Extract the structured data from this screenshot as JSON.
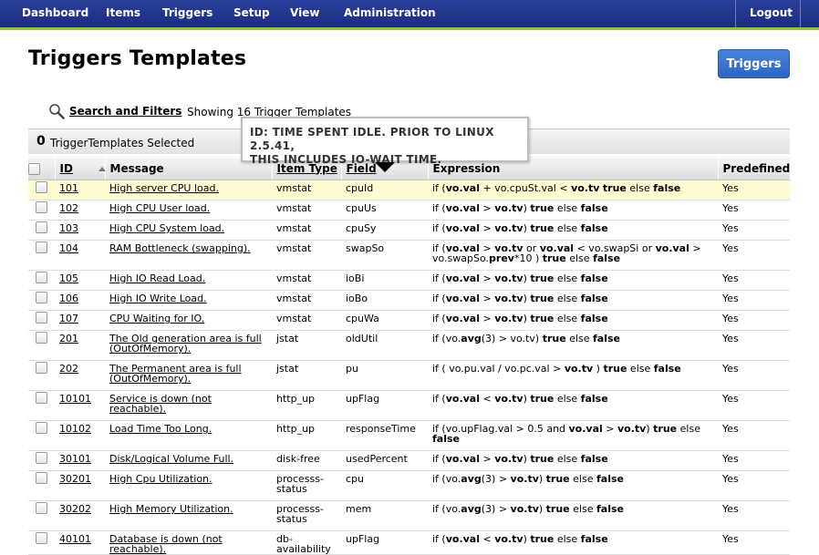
{
  "nav": {
    "items": [
      {
        "label": "Dashboard",
        "key": "dashboard"
      },
      {
        "label": "Items",
        "key": "items"
      },
      {
        "label": "Triggers",
        "key": "triggers"
      },
      {
        "label": "Setup",
        "key": "setup"
      },
      {
        "label": "View",
        "key": "view"
      },
      {
        "label": "Administration",
        "key": "administration"
      }
    ],
    "logout": "Logout"
  },
  "page": {
    "title": "Triggers Templates",
    "triggers_button": "Triggers",
    "search_link": "Search and Filters",
    "showing": "Showing 16 Trigger Templates",
    "selected_count": "0",
    "selected_label": "TriggerTemplates Selected"
  },
  "tooltip": {
    "line1": "ID: TIME SPENT IDLE. PRIOR TO LINUX 2.5.41,",
    "line2": "THIS INCLUDES IO-WAIT TIME."
  },
  "table": {
    "columns": [
      "ID",
      "Message",
      "Item Type",
      "Field",
      "Expression",
      "Predefined"
    ],
    "rows": [
      {
        "id": "101",
        "message": "High server CPU load.",
        "item_type": "vmstat",
        "field": "cpuId",
        "expression": [
          [
            "if (",
            0
          ],
          [
            "vo.val",
            1
          ],
          [
            " + vo.cpuSt.val < ",
            0
          ],
          [
            "vo.tv",
            1
          ],
          [
            " ",
            0
          ],
          [
            "true",
            1
          ],
          [
            " else ",
            0
          ],
          [
            "false",
            1
          ]
        ],
        "predefined": "Yes",
        "highlight": true
      },
      {
        "id": "102",
        "message": "High CPU User load.",
        "item_type": "vmstat",
        "field": "cpuUs",
        "expression": [
          [
            "if (",
            0
          ],
          [
            "vo.val",
            1
          ],
          [
            " > ",
            0
          ],
          [
            "vo.tv",
            1
          ],
          [
            ") ",
            0
          ],
          [
            "true",
            1
          ],
          [
            " else ",
            0
          ],
          [
            "false",
            1
          ]
        ],
        "predefined": "Yes"
      },
      {
        "id": "103",
        "message": "High CPU System load.",
        "item_type": "vmstat",
        "field": "cpuSy",
        "expression": [
          [
            "if (",
            0
          ],
          [
            "vo.val",
            1
          ],
          [
            " > ",
            0
          ],
          [
            "vo.tv",
            1
          ],
          [
            ") ",
            0
          ],
          [
            "true",
            1
          ],
          [
            " else ",
            0
          ],
          [
            "false",
            1
          ]
        ],
        "predefined": "Yes"
      },
      {
        "id": "104",
        "message": "RAM Bottleneck (swapping).",
        "item_type": "vmstat",
        "field": "swapSo",
        "expression": [
          [
            "if (",
            0
          ],
          [
            "vo.val",
            1
          ],
          [
            " > ",
            0
          ],
          [
            "vo.tv",
            1
          ],
          [
            " or ",
            0
          ],
          [
            "vo.val",
            1
          ],
          [
            " < vo.swapSi or ",
            0
          ],
          [
            "vo.val",
            1
          ],
          [
            " > vo.swapSo.",
            0
          ],
          [
            "prev",
            1
          ],
          [
            "*10 ) ",
            0
          ],
          [
            "true",
            1
          ],
          [
            " else ",
            0
          ],
          [
            "false",
            1
          ]
        ],
        "predefined": "Yes"
      },
      {
        "id": "105",
        "message": "High IO Read Load.",
        "item_type": "vmstat",
        "field": "ioBi",
        "expression": [
          [
            "if (",
            0
          ],
          [
            "vo.val",
            1
          ],
          [
            " > ",
            0
          ],
          [
            "vo.tv",
            1
          ],
          [
            ") ",
            0
          ],
          [
            "true",
            1
          ],
          [
            " else ",
            0
          ],
          [
            "false",
            1
          ]
        ],
        "predefined": "Yes"
      },
      {
        "id": "106",
        "message": "High IO Write Load.",
        "item_type": "vmstat",
        "field": "ioBo",
        "expression": [
          [
            "if (",
            0
          ],
          [
            "vo.val",
            1
          ],
          [
            " > ",
            0
          ],
          [
            "vo.tv",
            1
          ],
          [
            ") ",
            0
          ],
          [
            "true",
            1
          ],
          [
            " else ",
            0
          ],
          [
            "false",
            1
          ]
        ],
        "predefined": "Yes"
      },
      {
        "id": "107",
        "message": "CPU Waiting for IO.",
        "item_type": "vmstat",
        "field": "cpuWa",
        "expression": [
          [
            "if (",
            0
          ],
          [
            "vo.val",
            1
          ],
          [
            " > ",
            0
          ],
          [
            "vo.tv",
            1
          ],
          [
            ") ",
            0
          ],
          [
            "true",
            1
          ],
          [
            " else ",
            0
          ],
          [
            "false",
            1
          ]
        ],
        "predefined": "Yes"
      },
      {
        "id": "201",
        "message": "The Old generation area is full (OutOfMemory).",
        "item_type": "jstat",
        "field": "oldUtil",
        "expression": [
          [
            "if (vo.",
            0
          ],
          [
            "avg",
            1
          ],
          [
            "(3) > vo.tv) ",
            0
          ],
          [
            "true",
            1
          ],
          [
            " else ",
            0
          ],
          [
            "false",
            1
          ]
        ],
        "predefined": "Yes"
      },
      {
        "id": "202",
        "message": "The Permanent area is full (OutOfMemory).",
        "item_type": "jstat",
        "field": "pu",
        "expression": [
          [
            "if ( vo.pu.val / vo.pc.val > ",
            0
          ],
          [
            "vo.tv",
            1
          ],
          [
            " ) ",
            0
          ],
          [
            "true",
            1
          ],
          [
            " else ",
            0
          ],
          [
            "false",
            1
          ]
        ],
        "predefined": "Yes"
      },
      {
        "id": "10101",
        "message": "Service is down (not reachable).",
        "item_type": "http_up",
        "field": "upFlag",
        "expression": [
          [
            "if (",
            0
          ],
          [
            "vo.val",
            1
          ],
          [
            " < ",
            0
          ],
          [
            "vo.tv",
            1
          ],
          [
            ") ",
            0
          ],
          [
            "true",
            1
          ],
          [
            " else ",
            0
          ],
          [
            "false",
            1
          ]
        ],
        "predefined": "Yes"
      },
      {
        "id": "10102",
        "message": "Load Time Too Long.",
        "item_type": "http_up",
        "field": "responseTime",
        "expression": [
          [
            "if (vo.upFlag.val > 0.5 and ",
            0
          ],
          [
            "vo.val",
            1
          ],
          [
            " > ",
            0
          ],
          [
            "vo.tv",
            1
          ],
          [
            ") ",
            0
          ],
          [
            "true",
            1
          ],
          [
            " else ",
            0
          ],
          [
            "false",
            1
          ]
        ],
        "predefined": "Yes"
      },
      {
        "id": "30101",
        "message": "Disk/Logical Volume Full.",
        "item_type": "disk-free",
        "field": "usedPercent",
        "expression": [
          [
            "if (",
            0
          ],
          [
            "vo.val",
            1
          ],
          [
            " > ",
            0
          ],
          [
            "vo.tv",
            1
          ],
          [
            ") ",
            0
          ],
          [
            "true",
            1
          ],
          [
            " else ",
            0
          ],
          [
            "false",
            1
          ]
        ],
        "predefined": "Yes"
      },
      {
        "id": "30201",
        "message": "High Cpu Utilization.",
        "item_type": "processs-status",
        "field": "cpu",
        "expression": [
          [
            "if (vo.",
            0
          ],
          [
            "avg",
            1
          ],
          [
            "(3) > ",
            0
          ],
          [
            "vo.tv",
            1
          ],
          [
            ") ",
            0
          ],
          [
            "true",
            1
          ],
          [
            " else ",
            0
          ],
          [
            "false",
            1
          ]
        ],
        "predefined": "Yes"
      },
      {
        "id": "30202",
        "message": "High Memory Utilization.",
        "item_type": "processs-status",
        "field": "mem",
        "expression": [
          [
            "if (vo.",
            0
          ],
          [
            "avg",
            1
          ],
          [
            "(3) > ",
            0
          ],
          [
            "vo.tv",
            1
          ],
          [
            ") ",
            0
          ],
          [
            "true",
            1
          ],
          [
            " else ",
            0
          ],
          [
            "false",
            1
          ]
        ],
        "predefined": "Yes"
      },
      {
        "id": "40101",
        "message": "Database is down (not reachable).",
        "item_type": "db-availability",
        "field": "upFlag",
        "expression": [
          [
            "if (",
            0
          ],
          [
            "vo.val",
            1
          ],
          [
            " < ",
            0
          ],
          [
            "vo.tv",
            1
          ],
          [
            ") ",
            0
          ],
          [
            "true",
            1
          ],
          [
            " else ",
            0
          ],
          [
            "false",
            1
          ]
        ],
        "predefined": "Yes"
      }
    ]
  },
  "colors": {
    "nav_bg": "#1f3389",
    "nav_accent": "#8cc63f",
    "button": "#3b74d0",
    "highlight_row": "#fffbd3"
  }
}
